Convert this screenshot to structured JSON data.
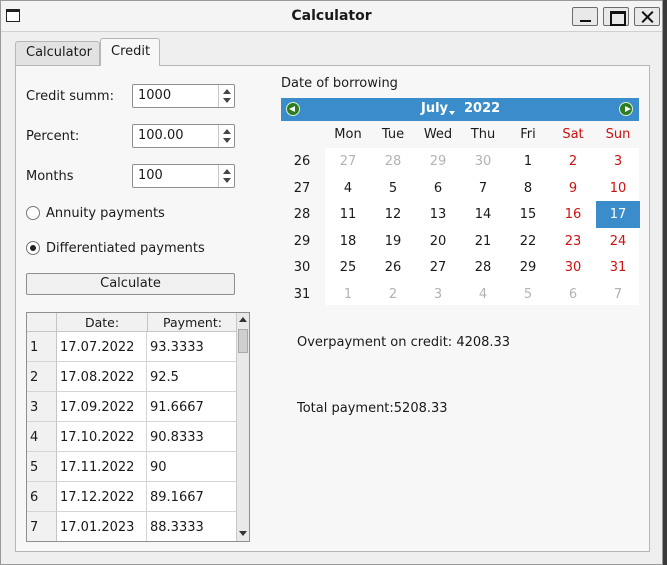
{
  "window": {
    "title": "Calculator"
  },
  "tabs": [
    {
      "label": "Calculator"
    },
    {
      "label": "Credit"
    }
  ],
  "form": {
    "credit_summ_label": "Credit summ:",
    "credit_summ_value": "1000",
    "percent_label": "Percent:",
    "percent_value": "100.00",
    "months_label": "Months",
    "months_value": "100",
    "annuity_label": "Annuity payments",
    "differentiated_label": "Differentiated payments",
    "selected_payment_type": "differentiated",
    "calculate_label": "Calculate"
  },
  "table": {
    "headers": [
      "Date:",
      "Payment:"
    ],
    "rows": [
      {
        "n": "1",
        "date": "17.07.2022",
        "payment": "93.3333"
      },
      {
        "n": "2",
        "date": "17.08.2022",
        "payment": "92.5"
      },
      {
        "n": "3",
        "date": "17.09.2022",
        "payment": "91.6667"
      },
      {
        "n": "4",
        "date": "17.10.2022",
        "payment": "90.8333"
      },
      {
        "n": "5",
        "date": "17.11.2022",
        "payment": "90"
      },
      {
        "n": "6",
        "date": "17.12.2022",
        "payment": "89.1667"
      },
      {
        "n": "7",
        "date": "17.01.2023",
        "payment": "88.3333"
      }
    ]
  },
  "calendar": {
    "label": "Date of borrowing",
    "month": "July",
    "year": "2022",
    "weekdays": [
      "Mon",
      "Tue",
      "Wed",
      "Thu",
      "Fri",
      "Sat",
      "Sun"
    ],
    "weeks": [
      {
        "num": "26",
        "days": [
          [
            "27",
            "dim"
          ],
          [
            "28",
            "dim"
          ],
          [
            "29",
            "dim"
          ],
          [
            "30",
            "dim"
          ],
          [
            "1",
            ""
          ],
          [
            "2",
            "red"
          ],
          [
            "3",
            "red"
          ]
        ]
      },
      {
        "num": "27",
        "days": [
          [
            "4",
            ""
          ],
          [
            "5",
            ""
          ],
          [
            "6",
            ""
          ],
          [
            "7",
            ""
          ],
          [
            "8",
            ""
          ],
          [
            "9",
            "red"
          ],
          [
            "10",
            "red"
          ]
        ]
      },
      {
        "num": "28",
        "days": [
          [
            "11",
            ""
          ],
          [
            "12",
            ""
          ],
          [
            "13",
            ""
          ],
          [
            "14",
            ""
          ],
          [
            "15",
            ""
          ],
          [
            "16",
            "red"
          ],
          [
            "17",
            "sel"
          ]
        ]
      },
      {
        "num": "29",
        "days": [
          [
            "18",
            ""
          ],
          [
            "19",
            ""
          ],
          [
            "20",
            ""
          ],
          [
            "21",
            ""
          ],
          [
            "22",
            ""
          ],
          [
            "23",
            "red"
          ],
          [
            "24",
            "red"
          ]
        ]
      },
      {
        "num": "30",
        "days": [
          [
            "25",
            ""
          ],
          [
            "26",
            ""
          ],
          [
            "27",
            ""
          ],
          [
            "28",
            ""
          ],
          [
            "29",
            ""
          ],
          [
            "30",
            "red"
          ],
          [
            "31",
            "red"
          ]
        ]
      },
      {
        "num": "31",
        "days": [
          [
            "1",
            "dim"
          ],
          [
            "2",
            "dim"
          ],
          [
            "3",
            "dim"
          ],
          [
            "4",
            "dim"
          ],
          [
            "5",
            "dim"
          ],
          [
            "6",
            "dim"
          ],
          [
            "7",
            "dim"
          ]
        ]
      }
    ],
    "weekend_color": "#cc1111",
    "selected_color": "#3a8dca"
  },
  "results": {
    "overpayment": "Overpayment on credit: 4208.33",
    "total": "Total payment:5208.33"
  }
}
